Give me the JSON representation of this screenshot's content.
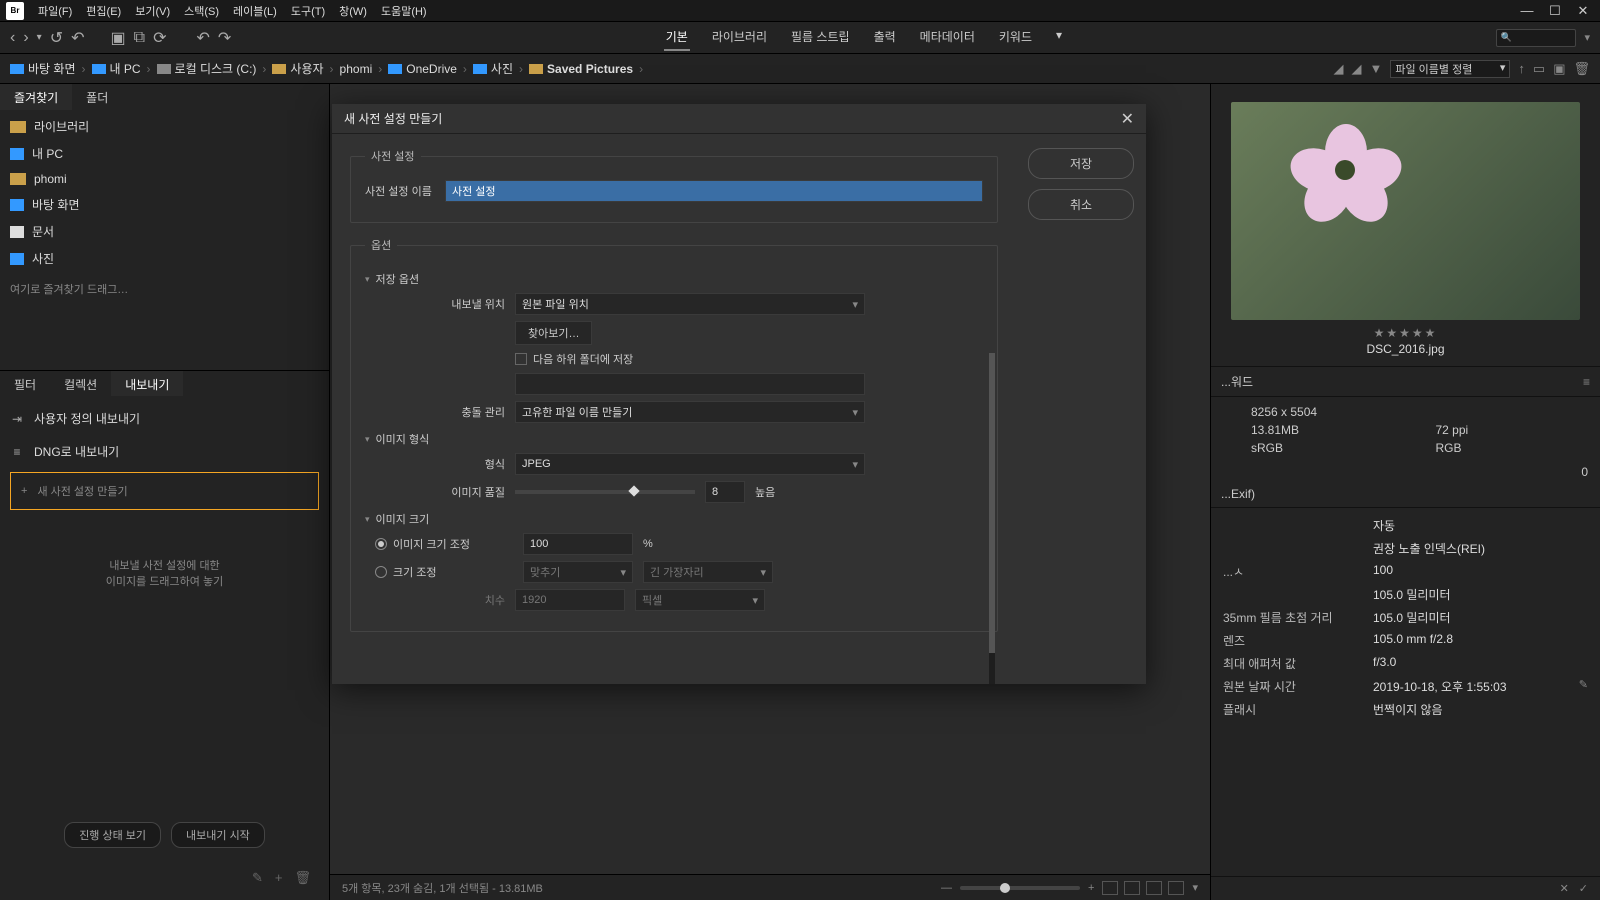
{
  "app": {
    "logo": "Br"
  },
  "menu": {
    "items": [
      "파일(F)",
      "편집(E)",
      "보기(V)",
      "스택(S)",
      "레이블(L)",
      "도구(T)",
      "창(W)",
      "도움말(H)"
    ]
  },
  "toolbar": {
    "tabs": [
      "기본",
      "라이브러리",
      "필름 스트립",
      "출력",
      "메타데이터",
      "키워드"
    ],
    "active_tab": "기본"
  },
  "path": {
    "crumbs": [
      "바탕 화면",
      "내 PC",
      "로컬 디스크 (C:)",
      "사용자",
      "phomi",
      "OneDrive",
      "사진",
      "Saved Pictures"
    ],
    "sort_label": "파일 이름별 정렬"
  },
  "favorites": {
    "tabs": [
      "즐겨찾기",
      "폴더"
    ],
    "items": [
      "라이브러리",
      "내 PC",
      "phomi",
      "바탕 화면",
      "문서",
      "사진"
    ],
    "drag_hint": "여기로 즐겨찾기 드래그…"
  },
  "export": {
    "tabs": [
      "필터",
      "컬렉션",
      "내보내기"
    ],
    "custom_export": "사용자 정의 내보내기",
    "dng_export": "DNG로 내보내기",
    "new_preset": "새 사전 설정 만들기",
    "drop_msg1": "내보낼 사전 설정에 대한",
    "drop_msg2": "이미지를 드래그하여 놓기",
    "btn_progress": "진행 상태 보기",
    "btn_start": "내보내기 시작"
  },
  "center": {
    "status": "5개 항목, 23개 숨김, 1개 선택됨 - 13.81MB"
  },
  "preview": {
    "filename": "DSC_2016.jpg",
    "stars": "★★★★★"
  },
  "keywords_header": "...워드",
  "meta": {
    "dims": "8256 x 5504",
    "size": "13.81MB",
    "dpi": "72 ppi",
    "space": "sRGB",
    "mode": "RGB",
    "zero": "0"
  },
  "exif": {
    "section": "...Exif)",
    "rows": [
      {
        "lab": "",
        "val": "자동"
      },
      {
        "lab": "",
        "val": "권장 노출 인덱스(REI)"
      },
      {
        "lab": "...ㅅ",
        "val": "100"
      },
      {
        "lab": "",
        "val": "105.0 밀리미터"
      },
      {
        "lab": "35mm 필름 초점 거리",
        "val": "105.0 밀리미터"
      },
      {
        "lab": "렌즈",
        "val": "105.0 mm f/2.8"
      },
      {
        "lab": "최대 애퍼처 값",
        "val": "f/3.0"
      },
      {
        "lab": "원본 날짜 시간",
        "val": "2019-10-18, 오후 1:55:03",
        "pen": true
      },
      {
        "lab": "플래시",
        "val": "번쩍이지 않음"
      }
    ]
  },
  "dialog": {
    "title": "새 사전 설정 만들기",
    "save": "저장",
    "cancel": "취소",
    "fs_preset": "사전 설정",
    "lab_name": "사전 설정 이름",
    "val_name": "사전 설정",
    "fs_options": "옵션",
    "sec_save": "저장 옵션",
    "lab_loc": "내보낼 위치",
    "val_loc": "원본 파일 위치",
    "btn_browse": "찾아보기…",
    "chk_subfolder": "다음 하위 폴더에 저장",
    "lab_conflict": "충돌 관리",
    "val_conflict": "고유한 파일 이름 만들기",
    "sec_format": "이미지 형식",
    "lab_format": "형식",
    "val_format": "JPEG",
    "lab_quality": "이미지 품질",
    "val_quality": "8",
    "txt_high": "높음",
    "sec_size": "이미지 크기",
    "rad_scale": "이미지 크기 조정",
    "val_scale": "100",
    "pct": "%",
    "rad_resize": "크기 조정",
    "val_fit": "맞추기",
    "val_edge": "긴 가장자리",
    "lab_dim": "치수",
    "val_dim": "1920",
    "val_unit": "픽셀"
  }
}
